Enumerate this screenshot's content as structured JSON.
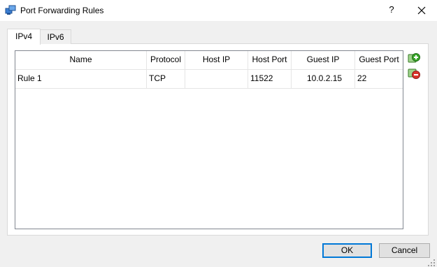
{
  "window": {
    "title": "Port Forwarding Rules",
    "help_label": "?",
    "icons": {
      "app": "network-adapter-icon",
      "close": "close-icon"
    }
  },
  "tabs": [
    {
      "label": "IPv4",
      "selected": true
    },
    {
      "label": "IPv6",
      "selected": false
    }
  ],
  "table": {
    "columns": [
      "Name",
      "Protocol",
      "Host IP",
      "Host Port",
      "Guest IP",
      "Guest Port"
    ],
    "rows": [
      [
        "Rule 1",
        "TCP",
        "",
        "11522",
        "10.0.2.15",
        "22"
      ]
    ]
  },
  "side_actions": {
    "add_icon": "add-rule-icon",
    "remove_icon": "remove-rule-icon"
  },
  "buttons": {
    "ok": "OK",
    "cancel": "Cancel"
  },
  "colors": {
    "accent": "#0078d7",
    "add_green": "#3aa82a",
    "remove_red": "#d9342b"
  }
}
